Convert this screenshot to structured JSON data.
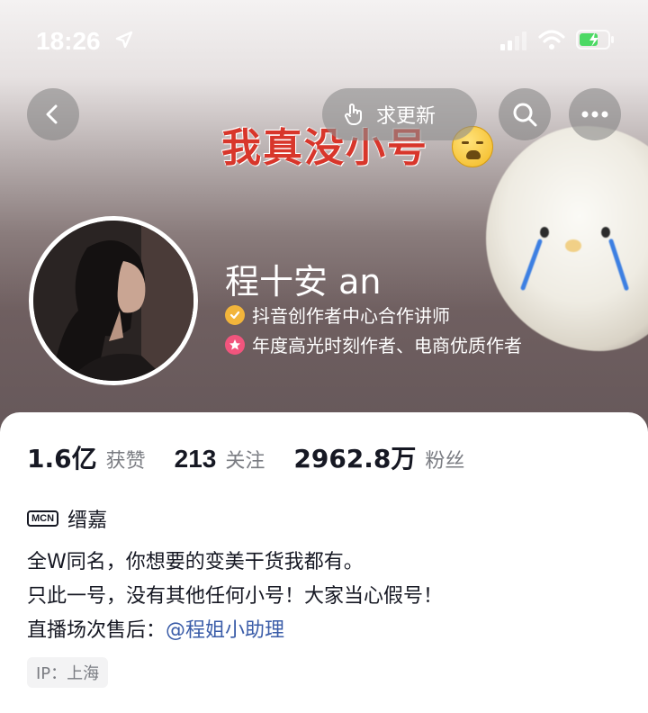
{
  "status_bar": {
    "time": "18:26"
  },
  "nav": {
    "update_label": "求更新"
  },
  "cover": {
    "title": "我真没小号"
  },
  "profile": {
    "name": "程十安 an",
    "certifications": [
      {
        "text": "抖音创作者中心合作讲师",
        "color": "#f2b53b"
      },
      {
        "text": "年度高光时刻作者、电商优质作者",
        "color": "#f1557d"
      }
    ]
  },
  "stats": [
    {
      "value": "1.6亿",
      "label": "获赞"
    },
    {
      "value": "213",
      "label": "关注"
    },
    {
      "value": "2962.8万",
      "label": "粉丝"
    }
  ],
  "mcn": {
    "badge": "MCN",
    "name": "缙嘉"
  },
  "bio": {
    "line1": "全W同名，你想要的变美干货我都有。",
    "line2": "只此一号，没有其他任何小号！大家当心假号！",
    "line3_prefix": "直播场次售后：",
    "line3_mention": "@程姐小助理"
  },
  "ip": "IP：上海",
  "colors": {
    "title_red": "#d8362b",
    "mention_blue": "#3a5ca8",
    "muted_text": "#7a7c82"
  }
}
